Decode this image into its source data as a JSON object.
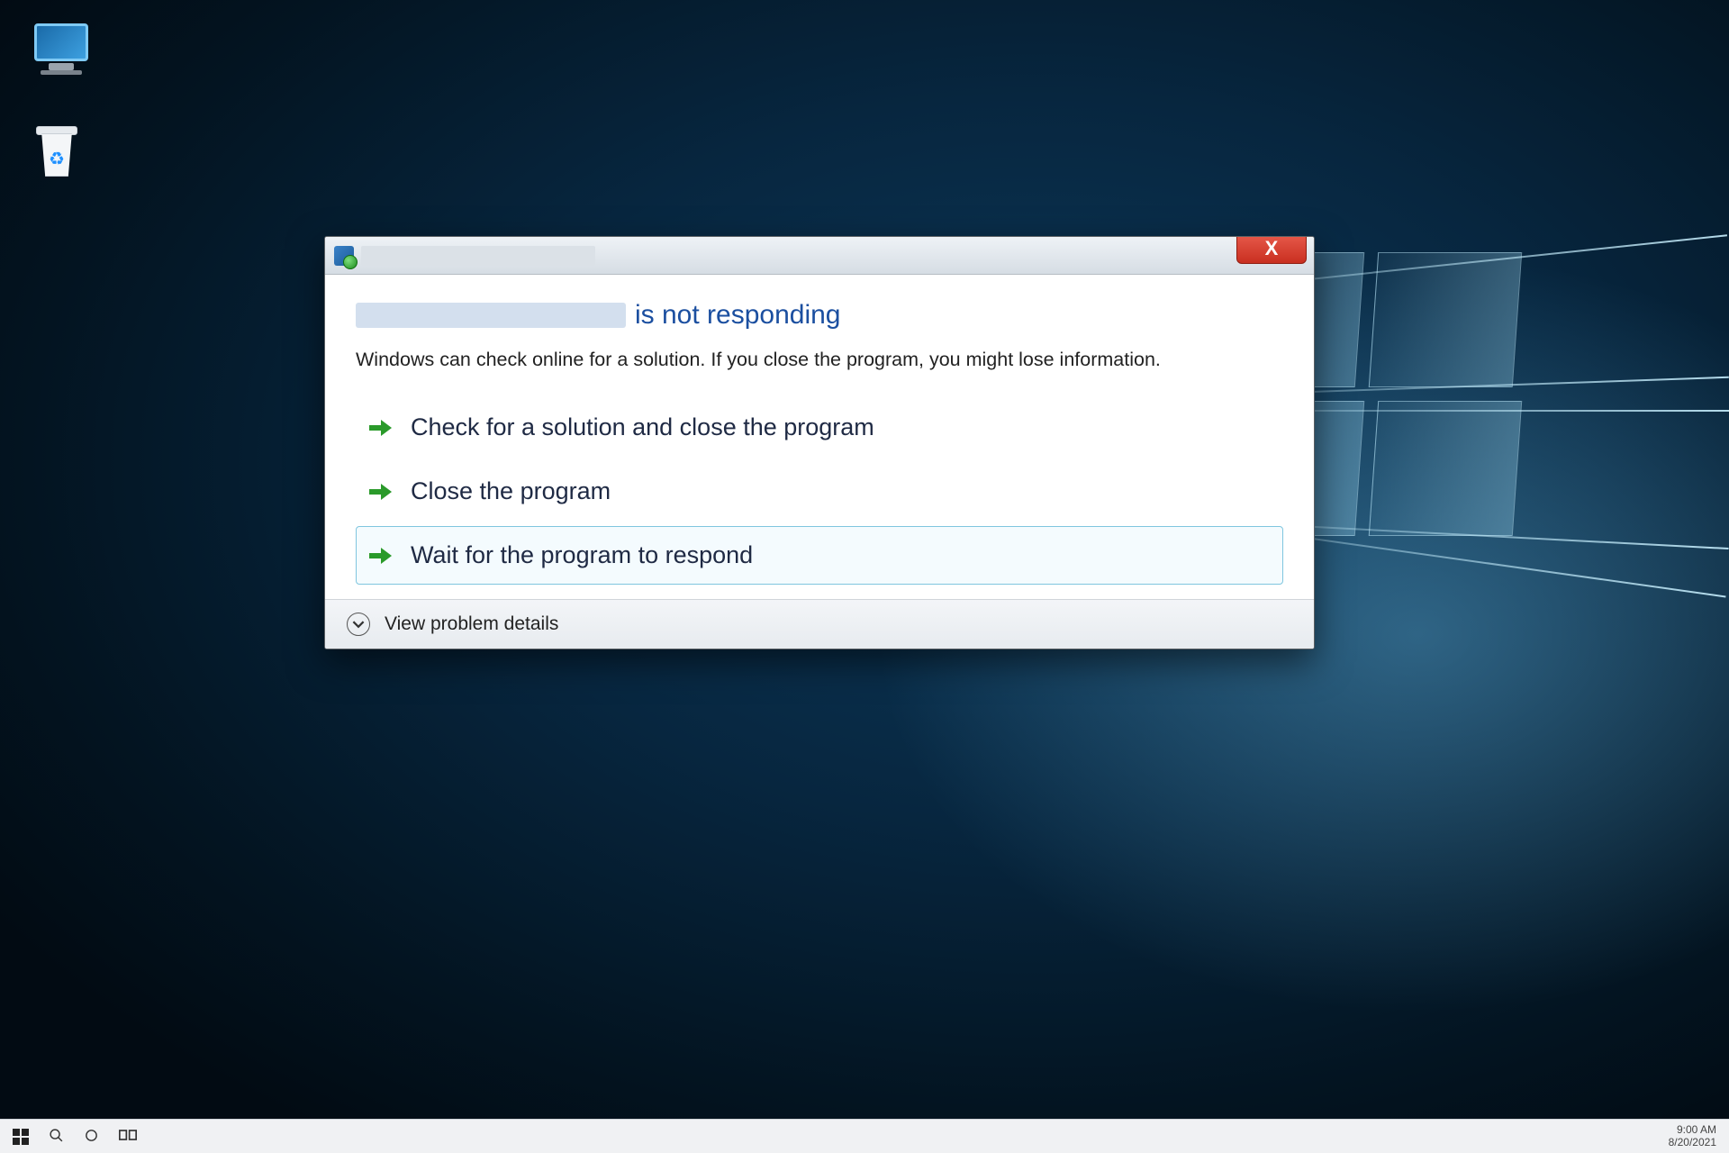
{
  "dialog": {
    "title_visible": "",
    "heading_program_name": "",
    "heading_suffix": "is not responding",
    "description": "Windows can check online for a solution. If you close the program, you might lose information.",
    "options": [
      {
        "label": "Check for a solution and close the program",
        "selected": false
      },
      {
        "label": "Close the program",
        "selected": false
      },
      {
        "label": "Wait for the program to respond",
        "selected": true
      }
    ],
    "details_toggle": "View problem details",
    "close_glyph": "X"
  },
  "desktop_icons": {
    "this_pc": "",
    "recycle_bin": ""
  },
  "taskbar": {
    "time": "9:00 AM",
    "date": "8/20/2021"
  }
}
